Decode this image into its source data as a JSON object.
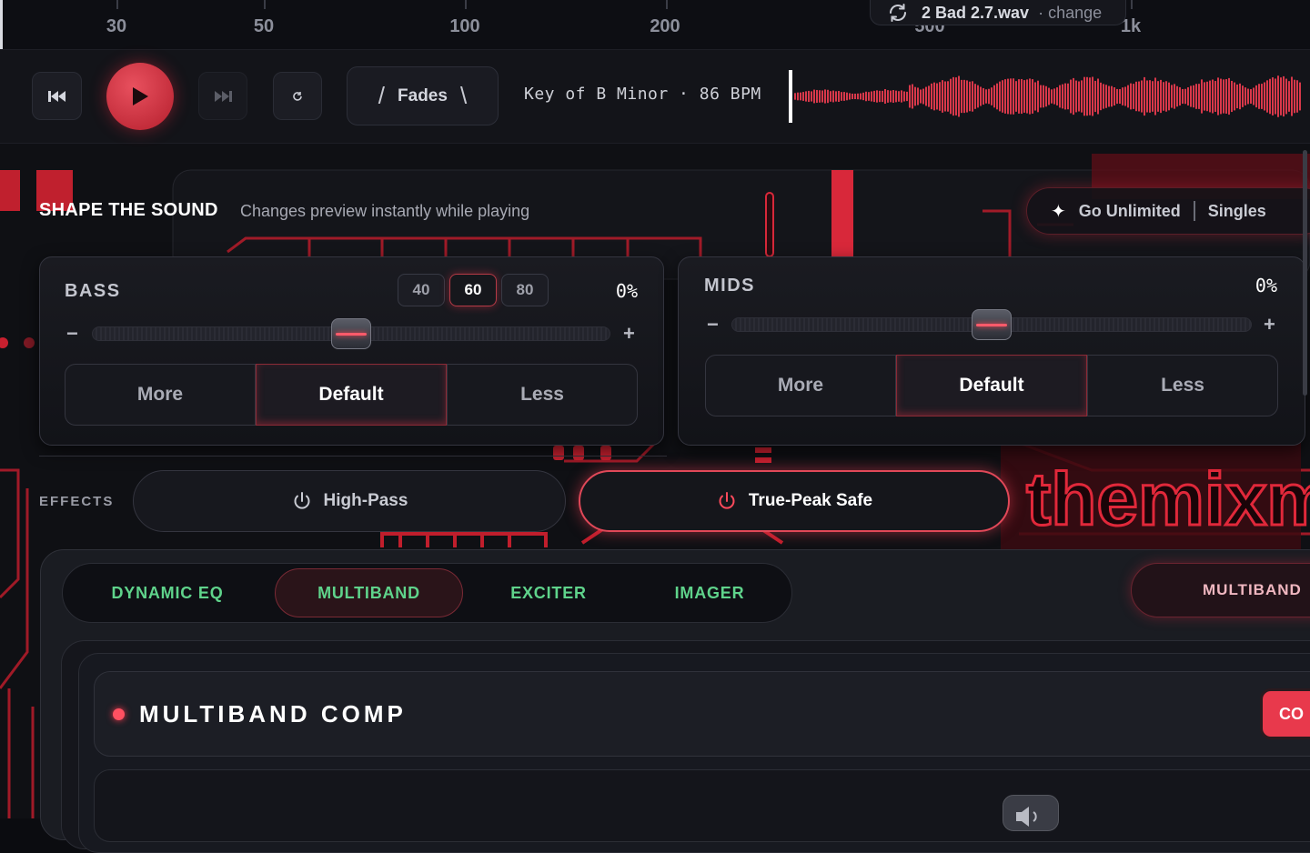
{
  "ruler": {
    "ticks": [
      "30",
      "50",
      "100",
      "200",
      "500",
      "1k"
    ]
  },
  "file": {
    "name": "2 Bad 2.7.wav",
    "change": "· change"
  },
  "transport": {
    "key_info": "Key of B Minor · 86 BPM",
    "fades_label": "Fades",
    "fades_left": "/",
    "fades_right": "\\"
  },
  "shape": {
    "title": "SHAPE THE SOUND",
    "subtitle": "Changes preview instantly while playing"
  },
  "upsell": {
    "go_unlimited": "Go Unlimited",
    "singles": "Singles"
  },
  "bass": {
    "title": "BASS",
    "value": "0%",
    "chips": [
      "40",
      "60",
      "80"
    ],
    "selected_chip": "60",
    "minus": "−",
    "plus": "+",
    "slider_level": 0.5,
    "options": [
      "More",
      "Default",
      "Less"
    ],
    "selected": "Default"
  },
  "mids": {
    "title": "MIDS",
    "value": "0%",
    "minus": "−",
    "plus": "+",
    "slider_level": 0.5,
    "options": [
      "More",
      "Default",
      "Less"
    ],
    "selected": "Default"
  },
  "effects": {
    "label": "EFFECTS",
    "high_pass": "High-Pass",
    "true_peak": "True-Peak Safe",
    "true_peak_on": true
  },
  "tabs": {
    "items": [
      "DYNAMIC EQ",
      "MULTIBAND",
      "EXCITER",
      "IMAGER"
    ],
    "active": "MULTIBAND",
    "side_pill": "MULTIBAND"
  },
  "module": {
    "title": "MULTIBAND COMP",
    "button": "CO"
  },
  "brand": {
    "logo_text": "themixm"
  },
  "colors": {
    "accent": "#e8394c",
    "tab_text": "#5fd38b",
    "background": "#0b0c10"
  }
}
